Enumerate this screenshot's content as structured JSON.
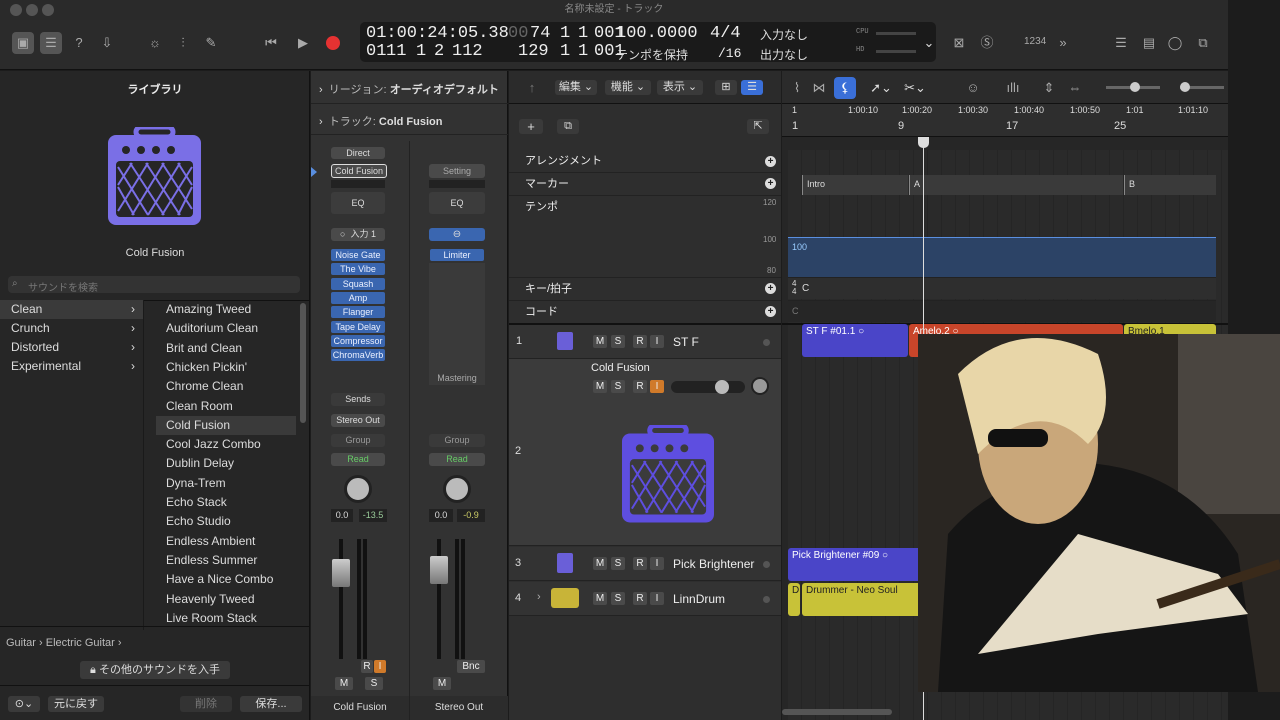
{
  "window": {
    "title": "名称未設定 - トラック"
  },
  "lcd": {
    "time": "01:00:24:05.38",
    "bars_a": "00",
    "bars_b": "74",
    "b1": "1",
    "b2": "1",
    "b3": "001",
    "bars2": "11",
    "beat2": "1",
    "div2": "2",
    "tick2": "112",
    "cnt": "129",
    "c1": "1",
    "c2": "1",
    "c3": "001",
    "tempo": "100.0000",
    "tempo_mode": "テンポを保持",
    "sig": "4/4",
    "div": "/16",
    "in": "入力なし",
    "out": "出力なし",
    "cpu": "CPU",
    "hd": "HD"
  },
  "toolbar": {
    "count_in": "1234"
  },
  "library": {
    "title": "ライブラリ",
    "preset_name": "Cold Fusion",
    "search_placeholder": "サウンドを検索",
    "categories": [
      "Clean",
      "Crunch",
      "Distorted",
      "Experimental"
    ],
    "sounds": [
      "Amazing Tweed",
      "Auditorium Clean",
      "Brit and Clean",
      "Chicken Pickin'",
      "Chrome Clean",
      "Clean Room",
      "Cold Fusion",
      "Cool Jazz Combo",
      "Dublin Delay",
      "Dyna-Trem",
      "Echo Stack",
      "Echo Studio",
      "Endless Ambient",
      "Endless Summer",
      "Have a Nice Combo",
      "Heavenly Tweed",
      "Live Room Stack"
    ],
    "breadcrumb": "Guitar › Electric Guitar ›",
    "get_more": "その他のサウンドを入手",
    "revert": "元に戻す",
    "delete": "削除",
    "save": "保存..."
  },
  "inspector": {
    "region_label": "リージョン:",
    "region_value": "オーディオデフォルト",
    "track_label": "トラック:",
    "track_value": "Cold Fusion"
  },
  "strip1": {
    "direct": "Direct",
    "setting": "Cold Fusion",
    "eq": "EQ",
    "input": "入力 1",
    "plugins": [
      "Noise Gate",
      "The Vibe",
      "Squash",
      "Amp",
      "Flanger",
      "Tape Delay",
      "Compressor",
      "ChromaVerb"
    ],
    "sends": "Sends",
    "output": "Stereo Out",
    "group": "Group",
    "auto": "Read",
    "pan": "0.0",
    "level": "-13.5",
    "r": "R",
    "i": "I",
    "m": "M",
    "s": "S",
    "name": "Cold Fusion"
  },
  "strip2": {
    "setting": "Setting",
    "eq": "EQ",
    "plugins": [
      "Limiter"
    ],
    "mastering": "Mastering",
    "group": "Group",
    "auto": "Read",
    "pan": "0.0",
    "level": "-0.9",
    "bnc": "Bnc",
    "m": "M",
    "name": "Stereo Out"
  },
  "menus": {
    "edit": "編集",
    "func": "機能",
    "view": "表示"
  },
  "global": {
    "arrangement": "アレンジメント",
    "marker": "マーカー",
    "tempo": "テンポ",
    "key": "キー/拍子",
    "chord": "コード",
    "t120": "120",
    "t100": "100",
    "t80": "80"
  },
  "ruler": {
    "bars": [
      "1",
      "9",
      "17",
      "25"
    ],
    "times": [
      "1",
      "1:00:10",
      "1:00:20",
      "1:00:30",
      "1:00:40",
      "1:00:50",
      "1:01",
      "1:01:10"
    ]
  },
  "markers": [
    "Intro",
    "A",
    "B"
  ],
  "tempo_value": "100",
  "sig_value": "C",
  "tracks": [
    {
      "num": "1",
      "name": "ST F"
    },
    {
      "num": "2",
      "name": "Cold Fusion"
    },
    {
      "num": "3",
      "name": "Pick Brightener"
    },
    {
      "num": "4",
      "name": "LinnDrum"
    }
  ],
  "regions": {
    "r1": "ST F #01.1",
    "r2": "Amelo.2",
    "r3": "Bmelo.1",
    "r4": "Pick Brightener #09",
    "r5": "Drummer - Neo Soul",
    "d": "D"
  },
  "colors": {
    "accent": "#3a6fd8",
    "record": "#e63232",
    "purple": "#5e4ee0",
    "amp_icon": "#7a6fe6",
    "region_blue": "#4a45c8",
    "region_red": "#c8452a",
    "region_yellow": "#c8c238"
  }
}
